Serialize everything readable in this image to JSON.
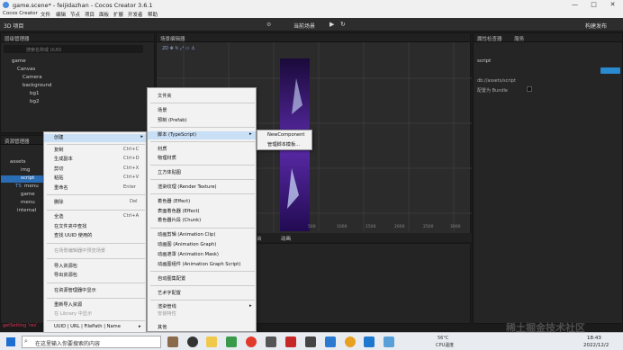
{
  "window": {
    "title": "game.scene* - feijidazhan - Cocos Creator 3.6.1",
    "controls": [
      "—",
      "□",
      "✕"
    ]
  },
  "menubar": [
    "Cocos Creator",
    "文件",
    "编辑",
    "节点",
    "项目",
    "面板",
    "扩展",
    "开发者",
    "帮助"
  ],
  "toolbar": {
    "mode": "3D 项目",
    "scene_select": "当前场景",
    "build": "构建发布"
  },
  "hierarchy": {
    "tab": "层级管理器",
    "search_placeholder": "搜索名称或 UUID",
    "nodes": [
      "game",
      "Canvas",
      "Camera",
      "background",
      "bg1",
      "bg2"
    ]
  },
  "scene": {
    "tab": "场景编辑器",
    "axis": [
      "500",
      "1000",
      "1500",
      "2000",
      "2500",
      "3000"
    ],
    "yaxis": [
      "2000",
      "1500",
      "1000",
      "500"
    ],
    "bottom_tabs": [
      "控制台",
      "动画"
    ]
  },
  "assets": {
    "tab": "资源管理器",
    "items": [
      "assets",
      "img",
      "script",
      "menu",
      "game",
      "menu",
      "internal"
    ],
    "ts_badge": "TS"
  },
  "inspector": {
    "tab": "属性检查器",
    "tab2": "服务",
    "folder": "script",
    "path": "db://assets/script",
    "bundle_label": "配置为 Bundle"
  },
  "console": {
    "text": "getSetting ‘res’"
  },
  "context_menu": [
    {
      "label": "创建",
      "shortcut": ""
    },
    {
      "label": "复制",
      "shortcut": "Ctrl+C"
    },
    {
      "label": "生成副本",
      "shortcut": "Ctrl+D"
    },
    {
      "label": "剪切",
      "shortcut": "Ctrl+X"
    },
    {
      "label": "粘贴",
      "shortcut": "Ctrl+V"
    },
    {
      "label": "重命名",
      "shortcut": "Enter"
    },
    {
      "label": "删除",
      "shortcut": "Del"
    },
    {
      "label": "全选",
      "shortcut": "Ctrl+A"
    },
    {
      "label": "在文件夹中查找",
      "shortcut": ""
    },
    {
      "label": "查找 UUID 使用的",
      "shortcut": ""
    },
    {
      "label": "在场景编辑器中预览场景",
      "shortcut": ""
    },
    {
      "label": "导入资源包",
      "shortcut": ""
    },
    {
      "label": "导出资源包",
      "shortcut": ""
    },
    {
      "label": "在资源管理器中显示",
      "shortcut": ""
    },
    {
      "label": "重新导入资源",
      "shortcut": ""
    },
    {
      "label": "在 Library 中显示",
      "shortcut": ""
    },
    {
      "label": "UUID | URL | FilePath | Name",
      "shortcut": ""
    }
  ],
  "create_menu": [
    "文件夹",
    "场景",
    "预制 (Prefab)",
    "脚本 (TypeScript)",
    "材质",
    "物理材质",
    "立方体贴图",
    "渲染纹理 (Render Texture)",
    "着色器 (Effect)",
    "表面着色器 (Effect)",
    "着色器片段 (Chunk)",
    "动画剪辑 (Animation Clip)",
    "动画图 (Animation Graph)",
    "动画遮罩 (Animation Mask)",
    "动画图组件 (Animation Graph Script)",
    "自动图集配置",
    "艺术字配置",
    "渲染管线",
    "库文件",
    "其他"
  ],
  "create_submenu_sub": [
    "渲染管线",
    "安装特性"
  ],
  "script_submenu": [
    "NewComponent",
    "管理脚本模板..."
  ],
  "taskbar": {
    "search_placeholder": "在这里输入你要搜索的内容",
    "weather": "56°C",
    "weather_sub": "CPU温度",
    "time": "18:43",
    "date": "2022/12/2"
  },
  "watermark": "稀土掘金技术社区"
}
